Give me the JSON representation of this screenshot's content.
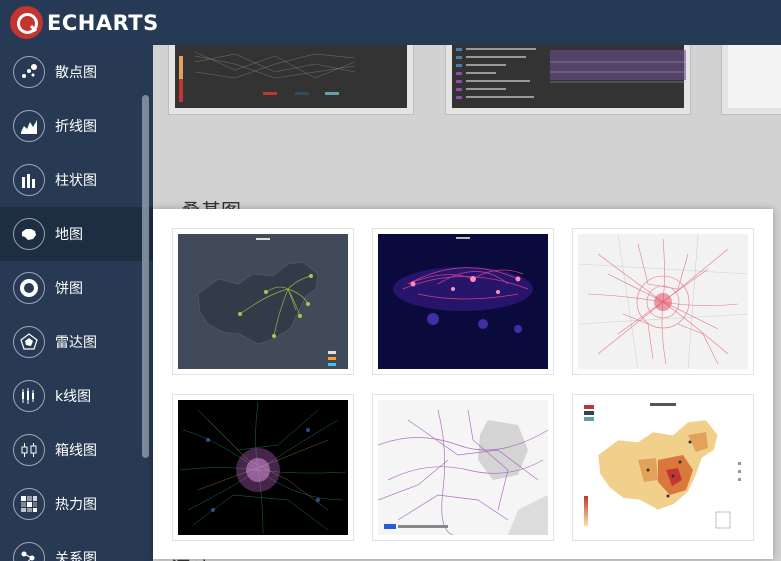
{
  "header": {
    "logo_text": "ECHARTS"
  },
  "sidebar": {
    "items": [
      {
        "label": "散点图",
        "icon": "scatter-icon"
      },
      {
        "label": "折线图",
        "icon": "line-chart-icon"
      },
      {
        "label": "柱状图",
        "icon": "bar-chart-icon"
      },
      {
        "label": "地图",
        "icon": "map-icon"
      },
      {
        "label": "饼图",
        "icon": "pie-chart-icon"
      },
      {
        "label": "雷达图",
        "icon": "radar-chart-icon"
      },
      {
        "label": "k线图",
        "icon": "candlestick-icon"
      },
      {
        "label": "箱线图",
        "icon": "boxplot-icon"
      },
      {
        "label": "热力图",
        "icon": "heatmap-icon"
      },
      {
        "label": "关系图",
        "icon": "graph-icon"
      }
    ],
    "active": "地图"
  },
  "main": {
    "section_title": "桑基图",
    "bottom_title": "漏斗"
  },
  "popup": {
    "thumbnails": [
      {
        "name": "thumb-china-flight-map"
      },
      {
        "name": "thumb-global-flights"
      },
      {
        "name": "thumb-beijing-bus-lines-light"
      },
      {
        "name": "thumb-beijing-bus-lines-dark"
      },
      {
        "name": "thumb-baidu-map-lines"
      },
      {
        "name": "thumb-china-province-map"
      }
    ]
  }
}
